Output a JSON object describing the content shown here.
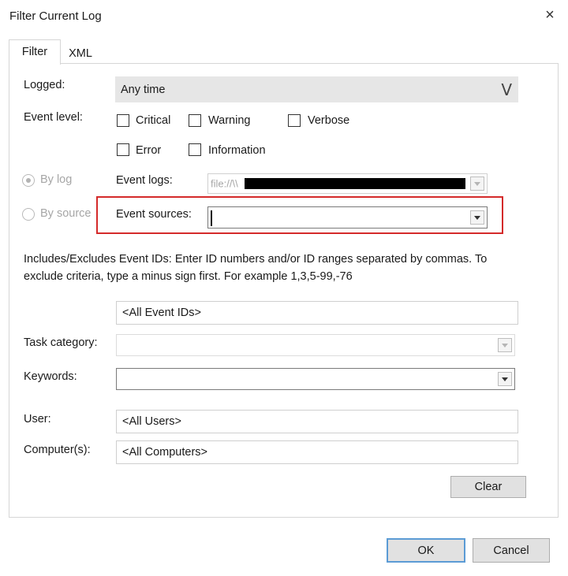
{
  "dialog": {
    "title": "Filter Current Log",
    "close_glyph": "×"
  },
  "tabs": [
    {
      "label": "Filter",
      "active": true
    },
    {
      "label": "XML",
      "active": false
    }
  ],
  "logged": {
    "label": "Logged:",
    "value": "Any time",
    "chevron": "V"
  },
  "event_level": {
    "label": "Event level:",
    "levels": [
      {
        "label": "Critical",
        "checked": false
      },
      {
        "label": "Warning",
        "checked": false
      },
      {
        "label": "Verbose",
        "checked": false
      },
      {
        "label": "Error",
        "checked": false
      },
      {
        "label": "Information",
        "checked": false
      }
    ]
  },
  "filter_by": [
    {
      "label": "By log",
      "selected": true,
      "enabled": false
    },
    {
      "label": "By source",
      "selected": false,
      "enabled": false
    }
  ],
  "event_logs": {
    "label": "Event logs:",
    "value": "file://\\\\"
  },
  "event_sources": {
    "label": "Event sources:",
    "value": ""
  },
  "event_ids": {
    "description": "Includes/Excludes Event IDs: Enter ID numbers and/or ID ranges separated by commas. To exclude criteria, type a minus sign first. For example 1,3,5-99,-76",
    "value": "<All Event IDs>"
  },
  "task_category": {
    "label": "Task category:",
    "value": ""
  },
  "keywords": {
    "label": "Keywords:",
    "value": ""
  },
  "user": {
    "label": "User:",
    "value": "<All Users>"
  },
  "computers": {
    "label": "Computer(s):",
    "value": "<All Computers>"
  },
  "buttons": {
    "clear": "Clear",
    "ok": "OK",
    "cancel": "Cancel"
  },
  "colors": {
    "highlight": "#d42a2a",
    "default_button_border": "#5b9bd5",
    "redaction": "#000000"
  }
}
